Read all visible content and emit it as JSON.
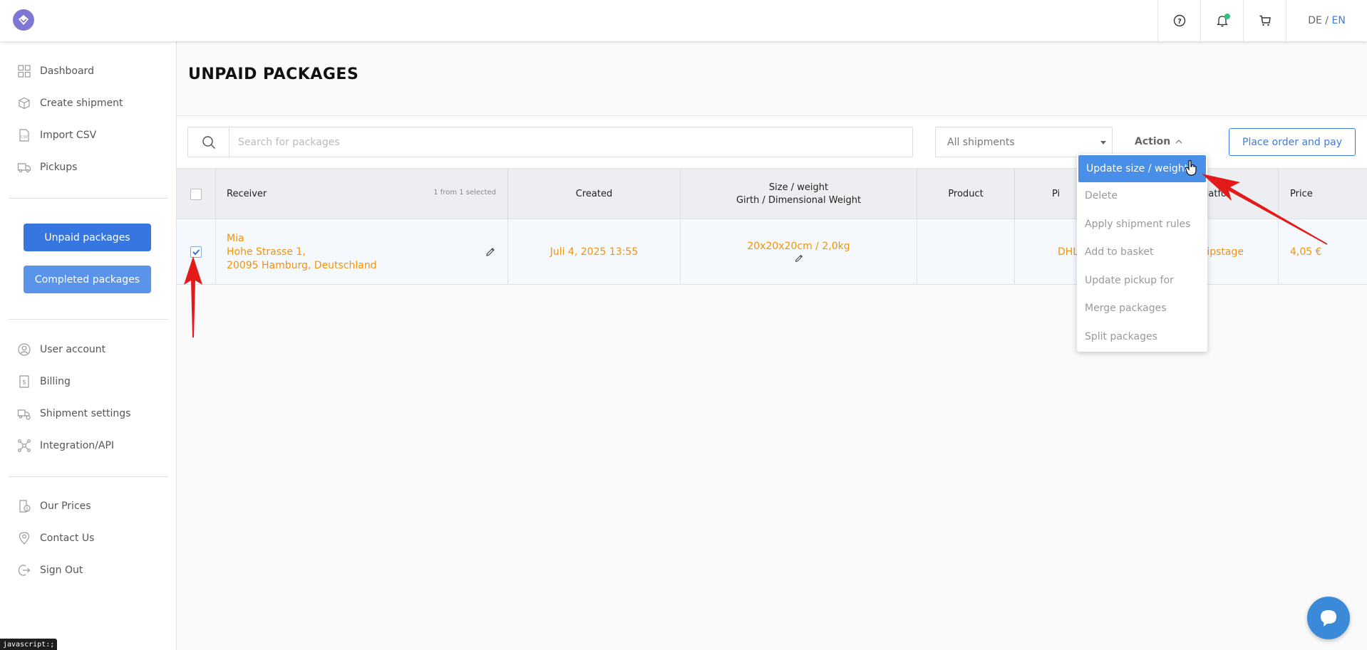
{
  "header": {
    "lang_de": "DE",
    "lang_sep": " / ",
    "lang_en": "EN",
    "icons": [
      "help-icon",
      "bell-icon",
      "cart-icon"
    ]
  },
  "sidebar": {
    "items_top": [
      {
        "label": "Dashboard",
        "icon": "grid-icon"
      },
      {
        "label": "Create shipment",
        "icon": "box-icon"
      },
      {
        "label": "Import CSV",
        "icon": "csv-file-icon"
      },
      {
        "label": "Pickups",
        "icon": "truck-icon"
      }
    ],
    "unpaid_button": "Unpaid packages",
    "completed_button": "Completed packages",
    "items_mid": [
      {
        "label": "User account",
        "icon": "user-icon"
      },
      {
        "label": "Billing",
        "icon": "billing-icon"
      },
      {
        "label": "Shipment settings",
        "icon": "shipment-settings-icon"
      },
      {
        "label": "Integration/API",
        "icon": "integration-icon"
      }
    ],
    "items_bottom": [
      {
        "label": "Our Prices",
        "icon": "prices-icon"
      },
      {
        "label": "Contact Us",
        "icon": "location-icon"
      },
      {
        "label": "Sign Out",
        "icon": "sign-out-icon"
      }
    ]
  },
  "main": {
    "title": "UNPAID PACKAGES",
    "search_placeholder": "Search for packages",
    "filter_selected": "All shipments",
    "action_label": "Action",
    "place_order_button": "Place order and pay"
  },
  "table": {
    "headers": {
      "receiver": "Receiver",
      "selection": "1 from 1 selected",
      "created": "Created",
      "size_line1": "Size / weight",
      "size_line2": "Girth / Dimensional Weight",
      "product": "Product",
      "pickup_partial": "Pi",
      "platform_partial": "latfo",
      "price": "Price"
    },
    "rows": [
      {
        "checked": true,
        "receiver_name": "Mia",
        "receiver_street": "Hohe Strasse 1,",
        "receiver_city": "20095 Hamburg, Deutschland",
        "created": "Juli 4, 2025 13:55",
        "size": "20x20x20cm / 2,0kg",
        "product": "",
        "pickup_partial": "DHL",
        "platform_partial": "hipstage",
        "price": "4,05 €"
      }
    ]
  },
  "action_menu": {
    "items": [
      "Update size / weight",
      "Delete",
      "Apply shipment rules",
      "Add to basket",
      "Update pickup for",
      "Merge packages",
      "Split packages"
    ],
    "highlighted": "Update size / weight"
  },
  "status_bar": "javascript:;",
  "colors": {
    "accent": "#3b7ddd",
    "orange": "#f0940a",
    "menu_highlight": "#4a8fe7",
    "arrow": "#e21a1a"
  }
}
